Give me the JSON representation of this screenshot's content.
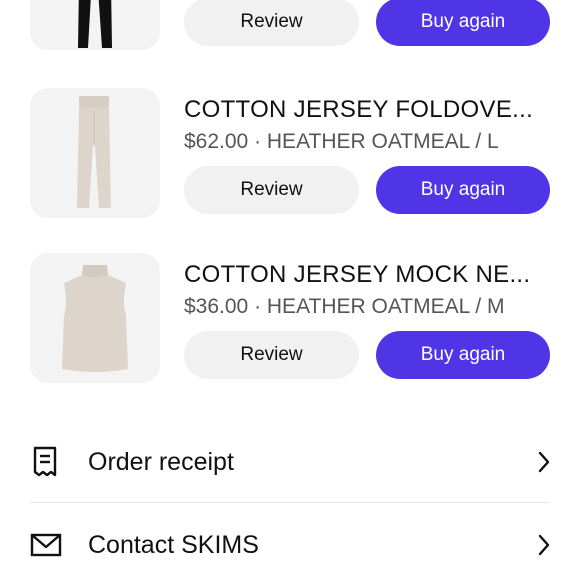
{
  "orders": {
    "items": [
      {
        "image": "black-pants-thumbnail",
        "review_label": "Review",
        "buy_again_label": "Buy again"
      },
      {
        "image": "oatmeal-foldover-pants-thumbnail",
        "title": "COTTON JERSEY FOLDOVE...",
        "meta": "$62.00 · HEATHER OATMEAL / L",
        "review_label": "Review",
        "buy_again_label": "Buy again"
      },
      {
        "image": "oatmeal-mock-neck-tank-thumbnail",
        "title": "COTTON JERSEY MOCK NE...",
        "meta": "$36.00 · HEATHER OATMEAL / M",
        "review_label": "Review",
        "buy_again_label": "Buy again"
      }
    ]
  },
  "links": {
    "receipt": {
      "icon": "receipt-icon",
      "label": "Order receipt",
      "chevron": "chevron-right-icon"
    },
    "contact": {
      "icon": "mail-icon",
      "label": "Contact SKIMS",
      "chevron": "chevron-right-icon"
    }
  },
  "colors": {
    "accent": "#4f35e6",
    "secondary_button": "#f1f1f1",
    "thumbnail_bg": "#f3f3f3",
    "product_oatmeal": "#ddd5cc",
    "product_black": "#111111"
  }
}
